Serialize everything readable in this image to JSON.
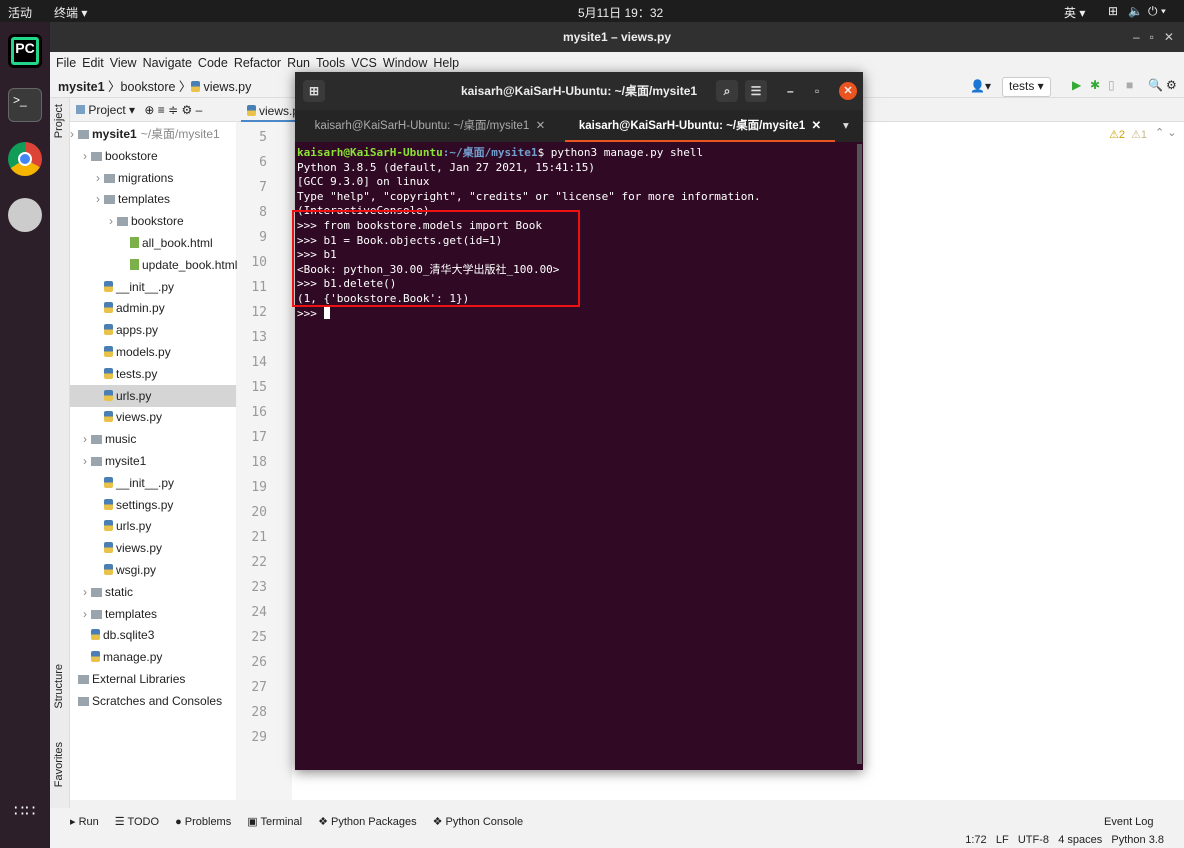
{
  "topbar": {
    "activities": "活动",
    "app": "终端 ▾",
    "clock": "5月11日 19：32",
    "lang": "英 ▾"
  },
  "window": {
    "title": "mysite1 – views.py"
  },
  "menu": [
    "File",
    "Edit",
    "View",
    "Navigate",
    "Code",
    "Refactor",
    "Run",
    "Tools",
    "VCS",
    "Window",
    "Help"
  ],
  "breadcrumb": [
    "mysite1",
    "bookstore",
    "views.py"
  ],
  "project": {
    "header": "Project ▾",
    "tree": [
      {
        "label": "mysite1",
        "extra": "~/桌面/mysite1",
        "level": 0,
        "type": "folder",
        "bold": true
      },
      {
        "label": "bookstore",
        "level": 1,
        "type": "folder"
      },
      {
        "label": "migrations",
        "level": 2,
        "type": "folder"
      },
      {
        "label": "templates",
        "level": 2,
        "type": "folder"
      },
      {
        "label": "bookstore",
        "level": 3,
        "type": "folder"
      },
      {
        "label": "all_book.html",
        "level": 4,
        "type": "html"
      },
      {
        "label": "update_book.html",
        "level": 4,
        "type": "html"
      },
      {
        "label": "__init__.py",
        "level": 2,
        "type": "py"
      },
      {
        "label": "admin.py",
        "level": 2,
        "type": "py"
      },
      {
        "label": "apps.py",
        "level": 2,
        "type": "py"
      },
      {
        "label": "models.py",
        "level": 2,
        "type": "py"
      },
      {
        "label": "tests.py",
        "level": 2,
        "type": "py"
      },
      {
        "label": "urls.py",
        "level": 2,
        "type": "py",
        "selected": true
      },
      {
        "label": "views.py",
        "level": 2,
        "type": "py"
      },
      {
        "label": "music",
        "level": 1,
        "type": "folder"
      },
      {
        "label": "mysite1",
        "level": 1,
        "type": "folder"
      },
      {
        "label": "__init__.py",
        "level": 2,
        "type": "py"
      },
      {
        "label": "settings.py",
        "level": 2,
        "type": "py"
      },
      {
        "label": "urls.py",
        "level": 2,
        "type": "py"
      },
      {
        "label": "views.py",
        "level": 2,
        "type": "py"
      },
      {
        "label": "wsgi.py",
        "level": 2,
        "type": "py"
      },
      {
        "label": "static",
        "level": 1,
        "type": "folder"
      },
      {
        "label": "templates",
        "level": 1,
        "type": "folder"
      },
      {
        "label": "db.sqlite3",
        "level": 1,
        "type": "file"
      },
      {
        "label": "manage.py",
        "level": 1,
        "type": "py"
      },
      {
        "label": "External Libraries",
        "level": 0,
        "type": "lib"
      },
      {
        "label": "Scratches and Consoles",
        "level": 0,
        "type": "lib"
      }
    ]
  },
  "leftstrip": [
    "Project",
    "Structure",
    "Favorites"
  ],
  "editor": {
    "tab": "views.py",
    "lines": [
      "5",
      "6",
      "7",
      "8",
      "9",
      "10",
      "11",
      "12",
      "13",
      "14",
      "15",
      "16",
      "17",
      "18",
      "19",
      "20",
      "21",
      "22",
      "23",
      "24",
      "25",
      "26",
      "27",
      "28",
      "29"
    ],
    "warnings": "⚠2",
    "weak_warnings": "⚠1"
  },
  "toolbar": {
    "run_config": "tests ▾"
  },
  "terminal": {
    "title": "kaisarh@KaiSarH-Ubuntu: ~/桌面/mysite1",
    "tabs": [
      "kaisarh@KaiSarH-Ubuntu: ~/桌面/mysite1",
      "kaisarh@KaiSarH-Ubuntu: ~/桌面/mysite1"
    ],
    "prompt_user": "kaisarh@KaiSarH-Ubuntu",
    "prompt_path": ":~/桌面/mysite1",
    "prompt_cmd": "$ python3 manage.py shell",
    "lines": [
      "Python 3.8.5 (default, Jan 27 2021, 15:41:15)",
      "[GCC 9.3.0] on linux",
      "Type \"help\", \"copyright\", \"credits\" or \"license\" for more information.",
      "(InteractiveConsole)",
      ">>> from bookstore.models import Book",
      ">>> b1 = Book.objects.get(id=1)",
      ">>> b1",
      "<Book: python_30.00_清华大学出版社_100.00>",
      ">>> b1.delete()",
      "(1, {'bookstore.Book': 1})"
    ],
    "last_prompt": ">>> "
  },
  "bottom_tabs": [
    "▸ Run",
    "☰ TODO",
    "● Problems",
    "▣ Terminal",
    "❖ Python Packages",
    "❖ Python Console"
  ],
  "event_log": "Event Log",
  "status": {
    "position": "1:72",
    "line_sep": "LF",
    "encoding": "UTF-8",
    "indent": "4 spaces",
    "interpreter": "Python 3.8"
  },
  "colors": {
    "terminal_bg": "#300a24",
    "prompt_user": "#4e9a06",
    "prompt_path": "#3465a4",
    "highlight_box": "#ee1111"
  }
}
